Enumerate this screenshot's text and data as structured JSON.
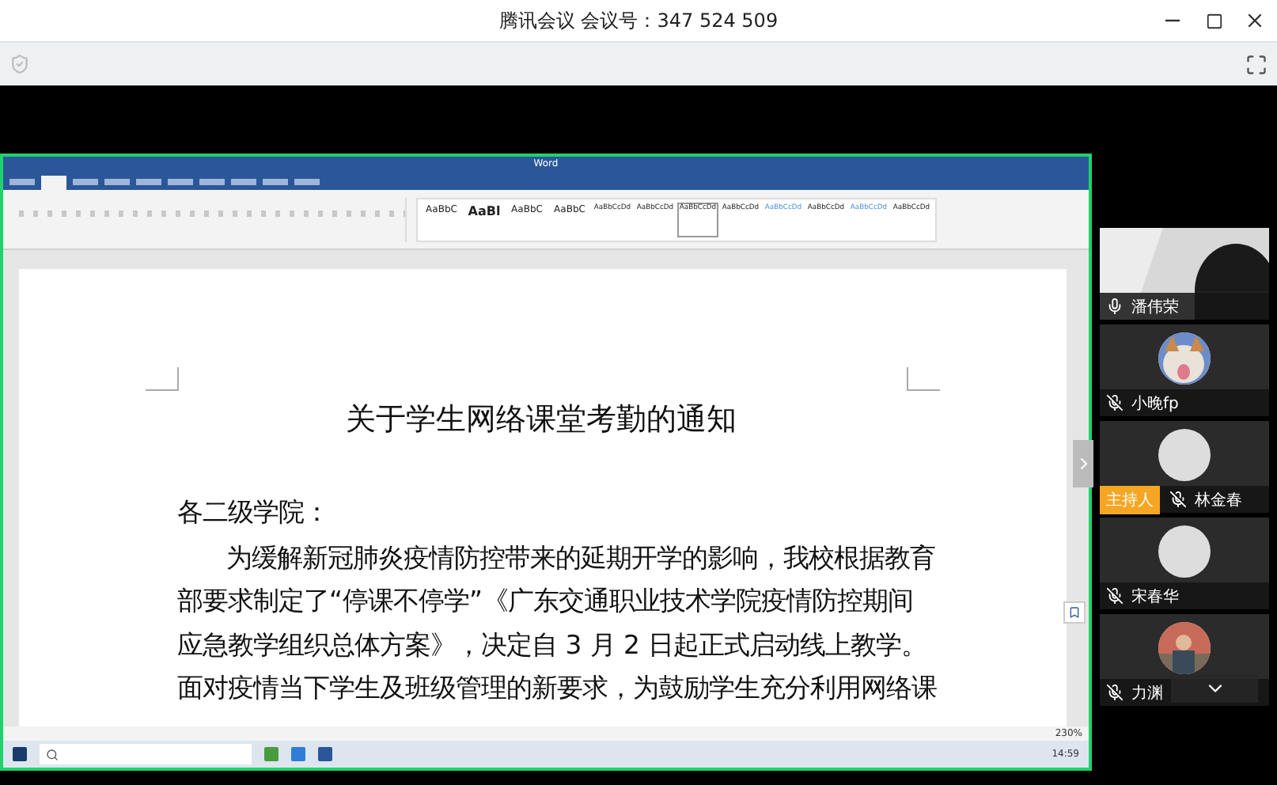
{
  "window": {
    "title": "腾讯会议 会议号：347 524 509"
  },
  "shared_screen": {
    "app_name": "Word",
    "ribbon_tabs": [
      {
        "selected": false
      },
      {
        "selected": true
      },
      {
        "selected": false
      },
      {
        "selected": false
      },
      {
        "selected": false
      },
      {
        "selected": false
      },
      {
        "selected": false
      },
      {
        "selected": false
      },
      {
        "selected": false
      },
      {
        "selected": false
      }
    ],
    "style_previews": [
      {
        "text": "AaBbC",
        "selected": false,
        "kind": "plain"
      },
      {
        "text": "AaBl",
        "selected": false,
        "kind": "heading"
      },
      {
        "text": "AaBbC",
        "selected": false,
        "kind": "plain"
      },
      {
        "text": "AaBbC",
        "selected": false,
        "kind": "plain"
      },
      {
        "text": "AaBbCcDd",
        "selected": false,
        "kind": "small"
      },
      {
        "text": "AaBbCcDd",
        "selected": false,
        "kind": "small"
      },
      {
        "text": "AaBbCcDd",
        "selected": true,
        "kind": "small"
      },
      {
        "text": "AaBbCcDd",
        "selected": false,
        "kind": "small"
      },
      {
        "text": "AaBbCcDd",
        "selected": false,
        "kind": "accent"
      },
      {
        "text": "AaBbCcDd",
        "selected": false,
        "kind": "small"
      },
      {
        "text": "AaBbCcDd",
        "selected": false,
        "kind": "accent"
      },
      {
        "text": "AaBbCcDd",
        "selected": false,
        "kind": "small"
      }
    ],
    "document": {
      "title": "关于学生网络课堂考勤的通知",
      "salutation": "各二级学院：",
      "lines": [
        "为缓解新冠肺炎疫情防控带来的延期开学的影响，我校根据教育",
        "部要求制定了“停课不停学”《广东交通职业技术学院疫情防控期间",
        "应急教学组织总体方案》，决定自 3 月 2 日起正式启动线上教学。",
        "面对疫情当下学生及班级管理的新要求，为鼓励学生充分利用网络课"
      ]
    },
    "zoom": "230%",
    "clock": "14:59"
  },
  "participants": [
    {
      "name": "潘伟荣",
      "muted": false,
      "kind": "video"
    },
    {
      "name": "小晚fp",
      "muted": true
    },
    {
      "name": "林金春",
      "muted": true,
      "kind": "default",
      "host_badge": "主持人"
    },
    {
      "name": "宋春华",
      "muted": true,
      "kind": "default"
    },
    {
      "name": "力渊",
      "muted": true
    }
  ]
}
